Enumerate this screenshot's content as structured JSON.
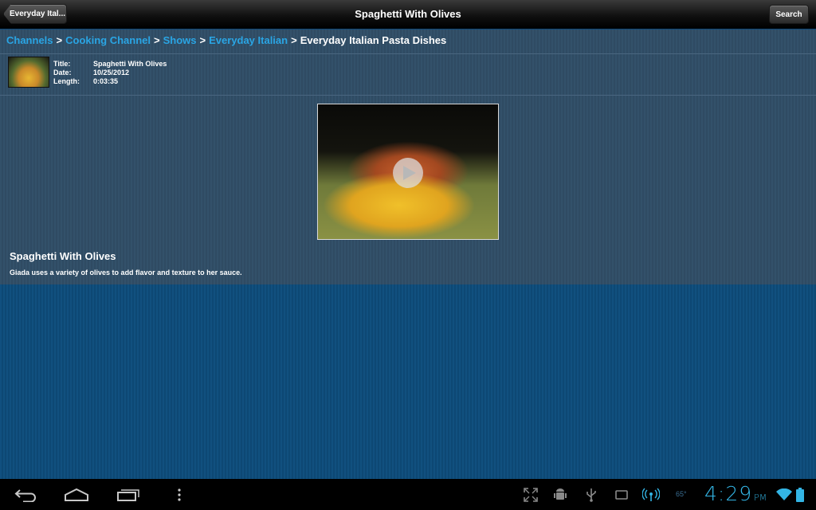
{
  "topbar": {
    "back_label": "Everyday Ital...",
    "title": "Spaghetti With Olives",
    "search_label": "Search"
  },
  "breadcrumb": {
    "items": [
      "Channels",
      "Cooking Channel",
      "Shows",
      "Everyday Italian"
    ],
    "separator": ">",
    "current": "Everyday Italian Pasta Dishes"
  },
  "meta": {
    "title_key": "Title:",
    "title_value": "Spaghetti With Olives",
    "date_key": "Date:",
    "date_value": "10/25/2012",
    "length_key": "Length:",
    "length_value": "0:03:35"
  },
  "description": {
    "title": "Spaghetti With Olives",
    "text": "Giada uses a variety of olives to add flavor and texture to her sauce."
  },
  "statusbar": {
    "temperature": "65°",
    "time": "4:29",
    "ampm": "PM"
  },
  "icons": {
    "back": "back-icon",
    "home": "home-icon",
    "recent_apps": "recent-apps-icon",
    "menu": "overflow-menu-icon",
    "play": "play-icon"
  },
  "colors": {
    "link": "#2aa5e4",
    "clock": "#33b5e5",
    "panel": "#33516a",
    "background": "#0e4878"
  }
}
